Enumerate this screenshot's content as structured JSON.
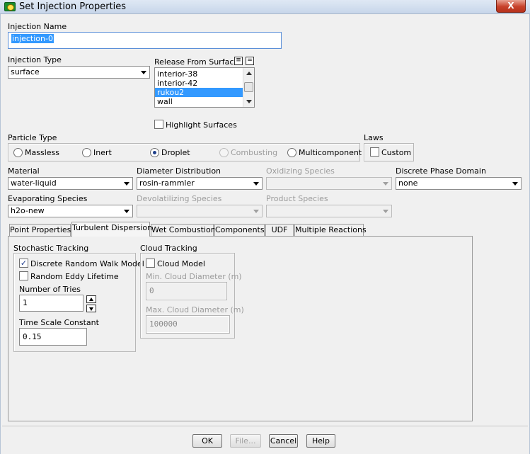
{
  "window": {
    "title": "Set Injection Properties",
    "close_label": "X"
  },
  "injection_name": {
    "label": "Injection Name",
    "value": "injection-0"
  },
  "injection_type": {
    "label": "Injection Type",
    "value": "surface"
  },
  "release_from_surfaces": {
    "label": "Release From Surfaces",
    "select_all_label": "≡",
    "deselect_all_label": "=",
    "items": [
      "interior-38",
      "interior-42",
      "rukou2",
      "wall"
    ],
    "selected": "rukou2"
  },
  "highlight_surfaces": {
    "label": "Highlight Surfaces",
    "checked": false
  },
  "particle_type": {
    "label": "Particle Type",
    "options": [
      "Massless",
      "Inert",
      "Droplet",
      "Combusting",
      "Multicomponent"
    ],
    "selected": "Droplet",
    "disabled": [
      "Combusting"
    ]
  },
  "laws": {
    "label": "Laws",
    "custom_label": "Custom",
    "custom_checked": false
  },
  "material": {
    "label": "Material",
    "value": "water-liquid"
  },
  "diameter_distribution": {
    "label": "Diameter Distribution",
    "value": "rosin-rammler"
  },
  "oxidizing_species": {
    "label": "Oxidizing Species",
    "value": ""
  },
  "discrete_phase_domain": {
    "label": "Discrete Phase Domain",
    "value": "none"
  },
  "evaporating_species": {
    "label": "Evaporating Species",
    "value": "h2o-new"
  },
  "devolatilizing_species": {
    "label": "Devolatilizing Species",
    "value": ""
  },
  "product_species": {
    "label": "Product Species",
    "value": ""
  },
  "tabs": [
    {
      "label": "Point Properties",
      "active": false
    },
    {
      "label": "Turbulent Dispersion",
      "active": true
    },
    {
      "label": "Wet Combustion",
      "active": false
    },
    {
      "label": "Components",
      "active": false
    },
    {
      "label": "UDF",
      "active": false
    },
    {
      "label": "Multiple Reactions",
      "active": false
    }
  ],
  "stochastic_tracking": {
    "label": "Stochastic Tracking",
    "discrete_random_walk": {
      "label": "Discrete Random Walk Model",
      "checked": true
    },
    "random_eddy_lifetime": {
      "label": "Random Eddy Lifetime",
      "checked": false
    },
    "number_of_tries": {
      "label": "Number of Tries",
      "value": "1"
    },
    "time_scale_constant": {
      "label": "Time Scale Constant",
      "value": "0.15"
    }
  },
  "cloud_tracking": {
    "label": "Cloud Tracking",
    "cloud_model": {
      "label": "Cloud Model",
      "checked": false
    },
    "min_cloud_diameter": {
      "label": "Min. Cloud Diameter (m)",
      "value": "0"
    },
    "max_cloud_diameter": {
      "label": "Max. Cloud Diameter (m)",
      "value": "100000"
    }
  },
  "buttons": {
    "ok": "OK",
    "file": "File...",
    "cancel": "Cancel",
    "help": "Help"
  },
  "colors": {
    "selection": "#3399ff",
    "title_bar": "#c7d6ea",
    "close_button": "#c7412a"
  }
}
